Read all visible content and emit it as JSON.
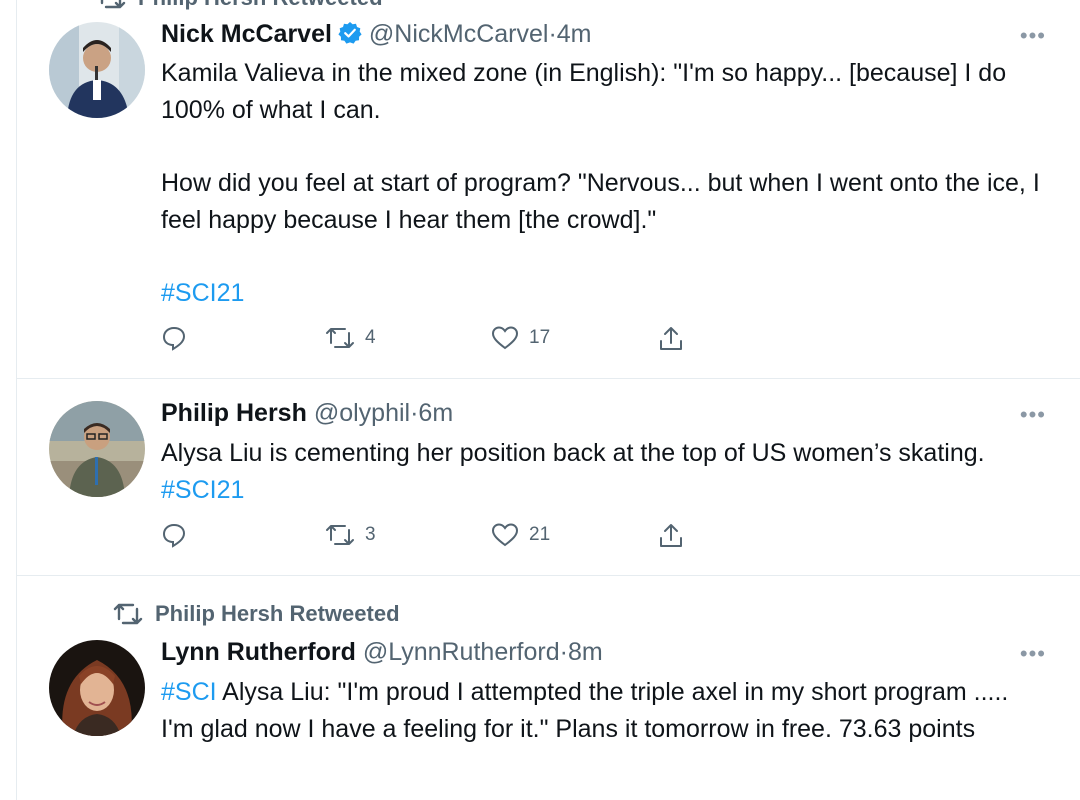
{
  "top_retweet": {
    "label": "Philip Hersh Retweeted"
  },
  "tweets": [
    {
      "name": "Nick McCarvel",
      "handle": "@NickMcCarvel",
      "separator": "·",
      "time": "4m",
      "verified": true,
      "more": "•••",
      "text": {
        "p1": "Kamila Valieva in the mixed zone (in English): \"I'm so happy... [because] I do 100% of what I can.",
        "p2": "How did you feel at start of program? \"Nervous... but when I went onto the ice, I feel happy because I hear them [the crowd].\"",
        "hashtag": "#SCI21"
      },
      "replies": "",
      "retweets": "4",
      "likes": "17"
    },
    {
      "name": "Philip Hersh",
      "handle": "@olyphil",
      "separator": "·",
      "time": "6m",
      "verified": false,
      "more": "•••",
      "text": {
        "p1": "Alysa Liu is cementing her position back at the top of US women’s skating.",
        "hashtag": "#SCI21"
      },
      "replies": "",
      "retweets": "3",
      "likes": "21"
    },
    {
      "retweeted_by": "Philip Hersh Retweeted",
      "name": "Lynn Rutherford",
      "handle": "@LynnRutherford",
      "separator": "·",
      "time": "8m",
      "verified": false,
      "more": "•••",
      "text": {
        "hashtag": "#SCI",
        "p1": "Alysa Liu: \"I'm proud I attempted the triple axel in my short program ..... I'm glad now I have a feeling for it.\" Plans it tomorrow in free. 73.63 points"
      }
    }
  ],
  "icons": {
    "reply": "reply-icon",
    "retweet": "retweet-icon",
    "like": "heart-icon",
    "share": "share-icon",
    "verified": "verified-badge-icon",
    "more": "more-options-icon"
  },
  "colors": {
    "link": "#1d9bf0",
    "secondary": "#536471",
    "verified": "#1d9bf0",
    "divider": "#e6ecf0"
  }
}
